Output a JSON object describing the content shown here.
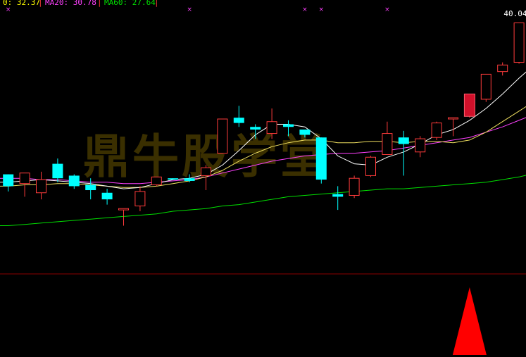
{
  "legend": {
    "ma_short": "0: 32.37",
    "ma20": "MA20: 30.78",
    "ma60": "MA60: 27.64",
    "sep": "|"
  },
  "colors": {
    "up": "#ff3b3b",
    "down": "#00ffff",
    "ma_short": "#ffffff",
    "ma10": "#f0e060",
    "ma20": "#ff40ff",
    "ma60": "#00e000",
    "marker": "#ff40ff",
    "divider": "#8b0000",
    "indicator": "#ff0000",
    "watermark": "#3a2f00"
  },
  "watermark_text": "鼎牛股学堂",
  "chart_data": {
    "type": "candlestick",
    "y_range": [
      20.8,
      40.9
    ],
    "peak_label": "40.04",
    "candles": [
      {
        "o": 28.2,
        "h": 28.2,
        "l": 26.9,
        "c": 27.3
      },
      {
        "o": 27.5,
        "h": 28.3,
        "l": 26.5,
        "c": 28.3
      },
      {
        "o": 26.8,
        "h": 28.4,
        "l": 26.3,
        "c": 27.8
      },
      {
        "o": 29.0,
        "h": 29.4,
        "l": 27.6,
        "c": 27.9
      },
      {
        "o": 28.1,
        "h": 28.2,
        "l": 27.1,
        "c": 27.3
      },
      {
        "o": 27.4,
        "h": 27.9,
        "l": 26.3,
        "c": 27.0
      },
      {
        "o": 26.8,
        "h": 27.1,
        "l": 25.9,
        "c": 26.3
      },
      {
        "o": 25.5,
        "h": 25.6,
        "l": 24.3,
        "c": 25.6
      },
      {
        "o": 25.8,
        "h": 27.3,
        "l": 25.4,
        "c": 26.9
      },
      {
        "o": 27.4,
        "h": 28.0,
        "l": 27.3,
        "c": 28.0
      },
      {
        "o": 27.9,
        "h": 27.9,
        "l": 27.8,
        "c": 27.8
      },
      {
        "o": 27.9,
        "h": 28.2,
        "l": 27.6,
        "c": 27.7
      },
      {
        "o": 28.1,
        "h": 28.9,
        "l": 27.0,
        "c": 28.7
      },
      {
        "o": 29.8,
        "h": 32.4,
        "l": 29.8,
        "c": 32.4
      },
      {
        "o": 32.5,
        "h": 33.4,
        "l": 31.8,
        "c": 32.1
      },
      {
        "o": 31.8,
        "h": 32.0,
        "l": 30.9,
        "c": 31.6
      },
      {
        "o": 31.3,
        "h": 33.2,
        "l": 30.9,
        "c": 32.2
      },
      {
        "o": 32.0,
        "h": 32.3,
        "l": 31.1,
        "c": 31.8
      },
      {
        "o": 31.6,
        "h": 31.6,
        "l": 31.0,
        "c": 31.2
      },
      {
        "o": 31.0,
        "h": 31.0,
        "l": 27.5,
        "c": 27.8
      },
      {
        "o": 26.7,
        "h": 27.3,
        "l": 25.5,
        "c": 26.5
      },
      {
        "o": 26.6,
        "h": 28.1,
        "l": 26.4,
        "c": 27.9
      },
      {
        "o": 28.1,
        "h": 29.6,
        "l": 28.0,
        "c": 29.5
      },
      {
        "o": 29.7,
        "h": 32.2,
        "l": 29.7,
        "c": 31.3
      },
      {
        "o": 31.0,
        "h": 31.5,
        "l": 28.1,
        "c": 30.5
      },
      {
        "o": 29.9,
        "h": 31.1,
        "l": 29.5,
        "c": 30.9
      },
      {
        "o": 31.0,
        "h": 32.2,
        "l": 30.8,
        "c": 32.1
      },
      {
        "o": 32.4,
        "h": 32.5,
        "l": 31.1,
        "c": 32.5
      },
      {
        "o": 32.6,
        "h": 34.3,
        "l": 32.5,
        "c": 34.3
      },
      {
        "o": 33.9,
        "h": 35.8,
        "l": 33.7,
        "c": 35.8
      },
      {
        "o": 36.0,
        "h": 36.7,
        "l": 35.7,
        "c": 36.5
      },
      {
        "o": 36.7,
        "h": 39.7,
        "l": 36.6,
        "c": 39.7
      },
      {
        "o": 39.5,
        "h": 40.3,
        "l": 36.5,
        "c": 39.0
      }
    ],
    "ma_short": [
      27.6,
      27.7,
      27.8,
      27.7,
      27.6,
      27.5,
      27.3,
      27.1,
      27.2,
      27.5,
      27.8,
      27.9,
      28.2,
      28.9,
      30.0,
      31.2,
      32.0,
      32.0,
      31.8,
      30.9,
      29.6,
      29.0,
      28.9,
      29.5,
      29.9,
      30.5,
      31.2,
      31.6,
      32.3,
      33.2,
      34.3,
      35.5,
      36.6
    ],
    "ma10": [
      27.3,
      27.4,
      27.4,
      27.5,
      27.5,
      27.4,
      27.3,
      27.2,
      27.2,
      27.3,
      27.5,
      27.7,
      28.0,
      28.5,
      29.2,
      29.8,
      30.3,
      30.6,
      30.8,
      30.8,
      30.6,
      30.6,
      30.7,
      30.7,
      30.6,
      30.7,
      30.7,
      30.6,
      30.8,
      31.4,
      32.2,
      33.0,
      33.8
    ],
    "ma20": [
      27.9,
      27.9,
      27.8,
      27.8,
      27.7,
      27.6,
      27.6,
      27.5,
      27.5,
      27.6,
      27.7,
      27.8,
      28.0,
      28.3,
      28.6,
      28.9,
      29.2,
      29.4,
      29.6,
      29.7,
      29.8,
      29.8,
      29.9,
      30.0,
      30.2,
      30.4,
      30.6,
      30.8,
      31.0,
      31.4,
      31.8,
      32.3,
      32.8
    ],
    "ma60": [
      24.3,
      24.4,
      24.5,
      24.6,
      24.7,
      24.8,
      24.9,
      25.0,
      25.1,
      25.2,
      25.4,
      25.5,
      25.6,
      25.8,
      25.9,
      26.1,
      26.3,
      26.5,
      26.6,
      26.7,
      26.8,
      26.9,
      27.0,
      27.1,
      27.1,
      27.2,
      27.3,
      27.4,
      27.5,
      27.6,
      27.8,
      28.0,
      28.3
    ],
    "marker_candles": [
      0,
      11,
      18,
      19,
      23
    ],
    "highlight_candle": 28,
    "indicator_peak_candle": 28
  }
}
